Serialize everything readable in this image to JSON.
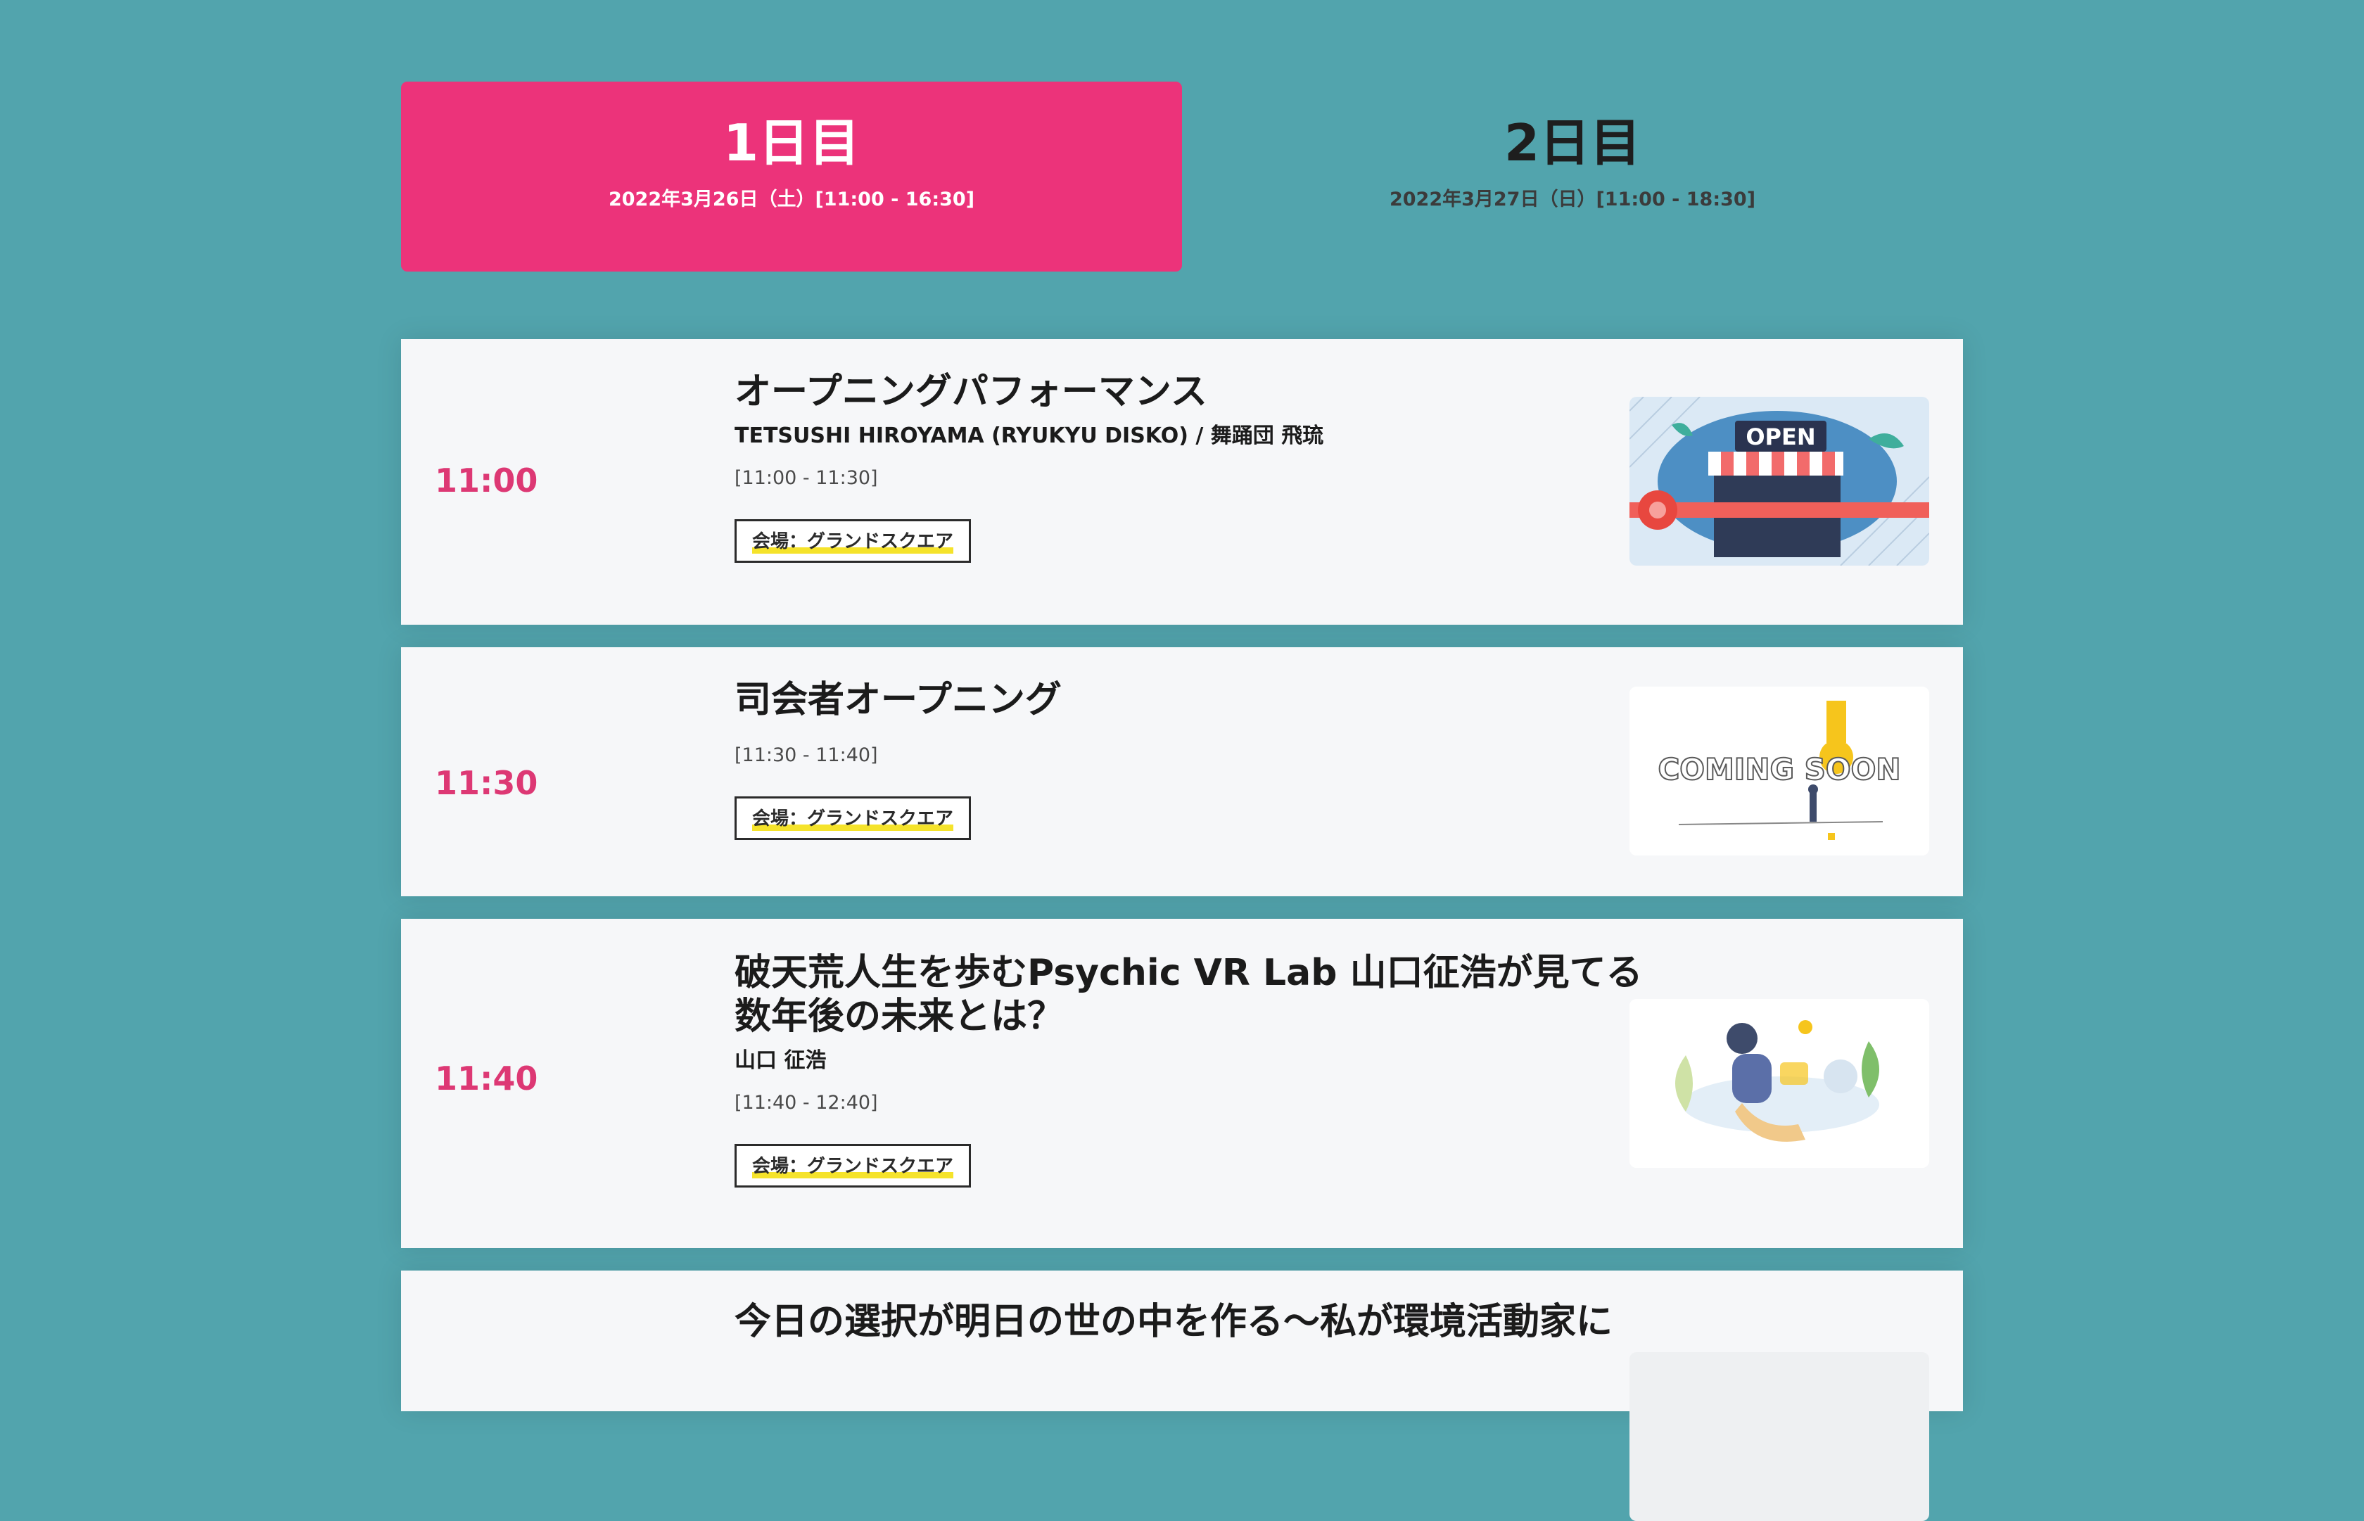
{
  "tabs": [
    {
      "title": "1日目",
      "date": "2022年3月26日（土）[11:00 - 16:30]",
      "active": true
    },
    {
      "title": "2日目",
      "date": "2022年3月27日（日）[11:00 - 18:30]",
      "active": false
    }
  ],
  "sessions": [
    {
      "time": "11:00",
      "title": "オープニングパフォーマンス",
      "speaker": "TETSUSHI HIROYAMA (RYUKYU DISKO) / 舞踊団 飛琉",
      "range": "[11:00 - 11:30]",
      "venue": "会場：グランドスクエア",
      "image_label": "OPEN"
    },
    {
      "time": "11:30",
      "title": "司会者オープニング",
      "range": "[11:30 - 11:40]",
      "venue": "会場：グランドスクエア",
      "image_label": "COMING SOON"
    },
    {
      "time": "11:40",
      "title_line1": "破天荒人生を歩むPsychic VR Lab 山口征浩が見てる",
      "title_line2": "数年後の未来とは？",
      "speaker": "山口 征浩",
      "range": "[11:40 - 12:40]",
      "venue": "会場：グランドスクエア"
    },
    {
      "title": "今日の選択が明日の世の中を作る〜私が環境活動家に"
    }
  ],
  "colors": {
    "background": "#52a4ad",
    "accent": "#ec337a",
    "time": "#dd3874",
    "card": "#f6f7f9",
    "underline": "#f5e32b"
  },
  "icons": [
    "open-storefront-illustration",
    "coming-soon-illustration",
    "vr-headset-illustration"
  ]
}
